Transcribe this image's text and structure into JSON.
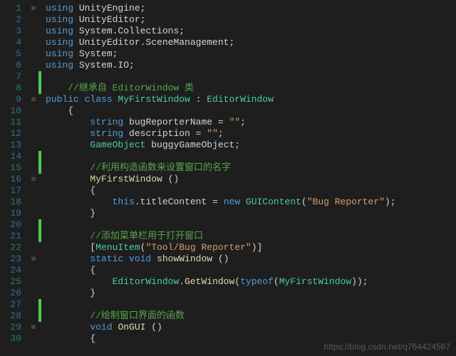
{
  "lines": [
    {
      "n": 1,
      "fold": "⊟",
      "mark": 0,
      "seg": [
        [
          "kw",
          "using"
        ],
        [
          "ns",
          " UnityEngine"
        ],
        [
          "pun",
          ";"
        ]
      ]
    },
    {
      "n": 2,
      "fold": "",
      "mark": 0,
      "seg": [
        [
          "kw",
          "using"
        ],
        [
          "ns",
          " UnityEditor"
        ],
        [
          "pun",
          ";"
        ]
      ]
    },
    {
      "n": 3,
      "fold": "",
      "mark": 0,
      "seg": [
        [
          "kw",
          "using"
        ],
        [
          "ns",
          " System.Collections"
        ],
        [
          "pun",
          ";"
        ]
      ]
    },
    {
      "n": 4,
      "fold": "",
      "mark": 0,
      "seg": [
        [
          "kw",
          "using"
        ],
        [
          "ns",
          " UnityEditor.SceneManagement"
        ],
        [
          "pun",
          ";"
        ]
      ]
    },
    {
      "n": 5,
      "fold": "",
      "mark": 0,
      "seg": [
        [
          "kw",
          "using"
        ],
        [
          "ns",
          " System"
        ],
        [
          "pun",
          ";"
        ]
      ]
    },
    {
      "n": 6,
      "fold": "",
      "mark": 0,
      "seg": [
        [
          "kw",
          "using"
        ],
        [
          "ns",
          " System.IO"
        ],
        [
          "pun",
          ";"
        ]
      ]
    },
    {
      "n": 7,
      "fold": "",
      "mark": 1,
      "seg": []
    },
    {
      "n": 8,
      "fold": "",
      "mark": 1,
      "seg": [
        [
          "pun",
          "    "
        ],
        [
          "cmt",
          "//继承自 EditorWindow 类"
        ]
      ]
    },
    {
      "n": 9,
      "fold": "⊟",
      "mark": 0,
      "seg": [
        [
          "kw",
          "public class"
        ],
        [
          "type",
          " MyFirstWindow"
        ],
        [
          "pun",
          " : "
        ],
        [
          "type",
          "EditorWindow"
        ]
      ]
    },
    {
      "n": 10,
      "fold": "",
      "mark": 0,
      "seg": [
        [
          "pun",
          "    {"
        ]
      ]
    },
    {
      "n": 11,
      "fold": "",
      "mark": 0,
      "seg": [
        [
          "pun",
          "        "
        ],
        [
          "kw",
          "string"
        ],
        [
          "var",
          " bugReporterName = "
        ],
        [
          "str",
          "\"\""
        ],
        [
          "pun",
          ";"
        ]
      ]
    },
    {
      "n": 12,
      "fold": "",
      "mark": 0,
      "seg": [
        [
          "pun",
          "        "
        ],
        [
          "kw",
          "string"
        ],
        [
          "var",
          " description = "
        ],
        [
          "str",
          "\"\""
        ],
        [
          "pun",
          ";"
        ]
      ]
    },
    {
      "n": 13,
      "fold": "",
      "mark": 0,
      "seg": [
        [
          "pun",
          "        "
        ],
        [
          "type",
          "GameObject"
        ],
        [
          "var",
          " buggyGameObject"
        ],
        [
          "pun",
          ";"
        ]
      ]
    },
    {
      "n": 14,
      "fold": "",
      "mark": 1,
      "seg": []
    },
    {
      "n": 15,
      "fold": "",
      "mark": 1,
      "seg": [
        [
          "pun",
          "        "
        ],
        [
          "cmt",
          "//利用构造函数来设置窗口的名字"
        ]
      ]
    },
    {
      "n": 16,
      "fold": "⊟",
      "mark": 0,
      "seg": [
        [
          "pun",
          "        "
        ],
        [
          "fn",
          "MyFirstWindow"
        ],
        [
          "pun",
          " ()"
        ]
      ]
    },
    {
      "n": 17,
      "fold": "",
      "mark": 0,
      "seg": [
        [
          "pun",
          "        {"
        ]
      ]
    },
    {
      "n": 18,
      "fold": "",
      "mark": 0,
      "seg": [
        [
          "pun",
          "            "
        ],
        [
          "kw",
          "this"
        ],
        [
          "pun",
          "."
        ],
        [
          "var",
          "titleContent"
        ],
        [
          "pun",
          " = "
        ],
        [
          "kw",
          "new"
        ],
        [
          "pun",
          " "
        ],
        [
          "type",
          "GUIContent"
        ],
        [
          "pun",
          "("
        ],
        [
          "str",
          "\"Bug Reporter\""
        ],
        [
          "pun",
          ");"
        ]
      ]
    },
    {
      "n": 19,
      "fold": "",
      "mark": 0,
      "seg": [
        [
          "pun",
          "        }"
        ]
      ]
    },
    {
      "n": 20,
      "fold": "",
      "mark": 1,
      "seg": []
    },
    {
      "n": 21,
      "fold": "",
      "mark": 1,
      "seg": [
        [
          "pun",
          "        "
        ],
        [
          "cmt",
          "//添加菜单栏用于打开窗口"
        ]
      ]
    },
    {
      "n": 22,
      "fold": "",
      "mark": 0,
      "seg": [
        [
          "pun",
          "        ["
        ],
        [
          "attr",
          "MenuItem"
        ],
        [
          "pun",
          "("
        ],
        [
          "str",
          "\"Tool/Bug Reporter\""
        ],
        [
          "pun",
          ")]"
        ]
      ]
    },
    {
      "n": 23,
      "fold": "⊟",
      "mark": 0,
      "seg": [
        [
          "pun",
          "        "
        ],
        [
          "kw",
          "static void"
        ],
        [
          "fn",
          " showWindow"
        ],
        [
          "pun",
          " ()"
        ]
      ]
    },
    {
      "n": 24,
      "fold": "",
      "mark": 0,
      "seg": [
        [
          "pun",
          "        {"
        ]
      ]
    },
    {
      "n": 25,
      "fold": "",
      "mark": 0,
      "seg": [
        [
          "pun",
          "            "
        ],
        [
          "type",
          "EditorWindow"
        ],
        [
          "pun",
          "."
        ],
        [
          "fn",
          "GetWindow"
        ],
        [
          "pun",
          "("
        ],
        [
          "kw",
          "typeof"
        ],
        [
          "pun",
          "("
        ],
        [
          "type",
          "MyFirstWindow"
        ],
        [
          "pun",
          "));"
        ]
      ]
    },
    {
      "n": 26,
      "fold": "",
      "mark": 0,
      "seg": [
        [
          "pun",
          "        }"
        ]
      ]
    },
    {
      "n": 27,
      "fold": "",
      "mark": 1,
      "seg": []
    },
    {
      "n": 28,
      "fold": "",
      "mark": 1,
      "seg": [
        [
          "pun",
          "        "
        ],
        [
          "cmt",
          "//绘制窗口界面的函数"
        ]
      ]
    },
    {
      "n": 29,
      "fold": "⊟",
      "mark": 0,
      "seg": [
        [
          "pun",
          "        "
        ],
        [
          "kw",
          "void"
        ],
        [
          "fn",
          " OnGUI"
        ],
        [
          "pun",
          " ()"
        ]
      ]
    },
    {
      "n": 30,
      "fold": "",
      "mark": 0,
      "seg": [
        [
          "pun",
          "        {"
        ]
      ]
    }
  ],
  "watermark": "https://blog.csdn.net/q764424567"
}
